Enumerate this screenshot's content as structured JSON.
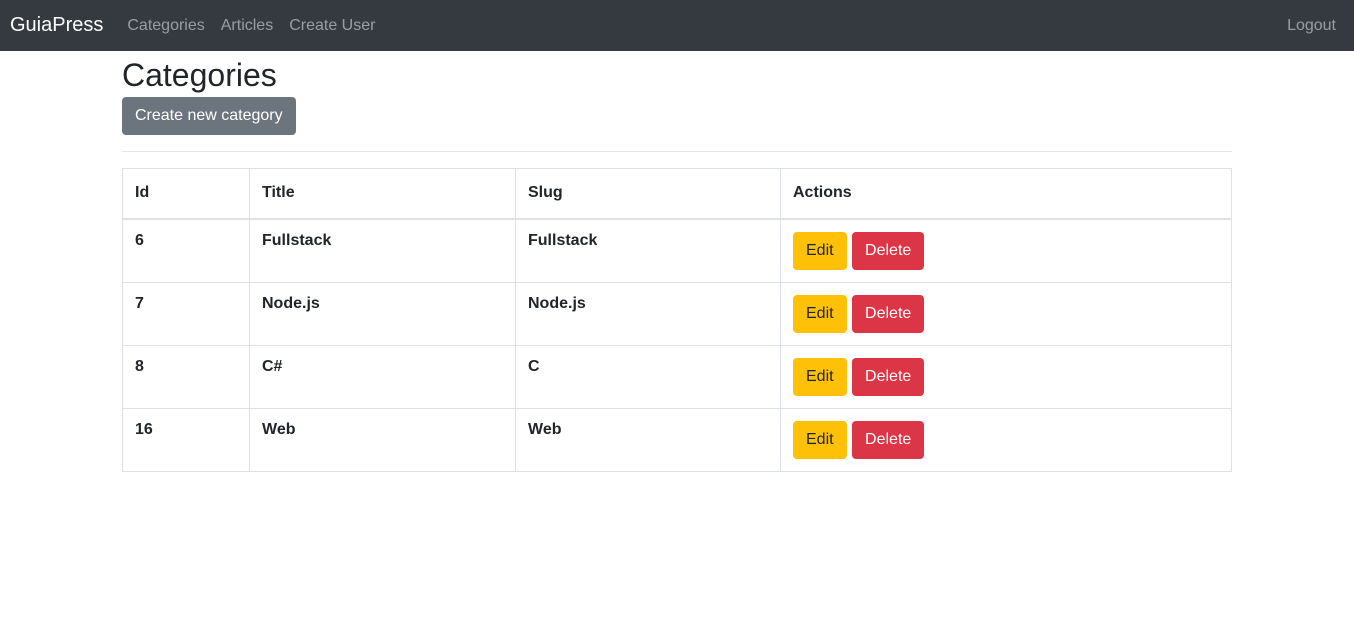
{
  "navbar": {
    "brand": "GuiaPress",
    "links": [
      "Categories",
      "Articles",
      "Create User"
    ],
    "logout": "Logout"
  },
  "page": {
    "title": "Categories",
    "create_button": "Create new category"
  },
  "table": {
    "headers": [
      "Id",
      "Title",
      "Slug",
      "Actions"
    ],
    "rows": [
      {
        "id": "6",
        "title": "Fullstack",
        "slug": "Fullstack"
      },
      {
        "id": "7",
        "title": "Node.js",
        "slug": "Node.js"
      },
      {
        "id": "8",
        "title": "C#",
        "slug": "C"
      },
      {
        "id": "16",
        "title": "Web",
        "slug": "Web"
      }
    ],
    "edit_label": "Edit",
    "delete_label": "Delete"
  }
}
